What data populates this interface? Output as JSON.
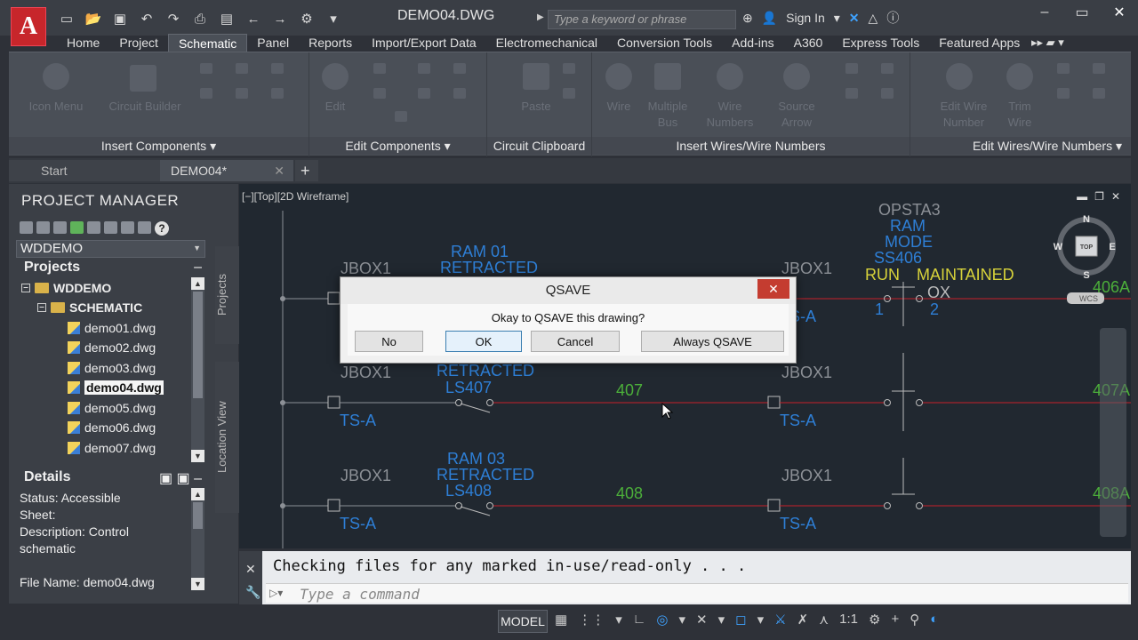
{
  "app": {
    "logo_letter": "A",
    "document_title": "DEMO04.DWG",
    "search_placeholder": "Type a keyword or phrase",
    "sign_in": "Sign In"
  },
  "ribbon": {
    "tabs": [
      "Home",
      "Project",
      "Schematic",
      "Panel",
      "Reports",
      "Import/Export Data",
      "Electromechanical",
      "Conversion Tools",
      "Add-ins",
      "A360",
      "Express Tools",
      "Featured Apps"
    ],
    "active_tab": "Schematic",
    "groups": [
      {
        "label": "Insert Components",
        "tools": [
          "Icon Menu",
          "Circuit Builder"
        ]
      },
      {
        "label": "Edit Components",
        "tools": [
          "Edit"
        ]
      },
      {
        "label": "Circuit Clipboard",
        "tools": [
          "Paste"
        ]
      },
      {
        "label": "Insert Wires/Wire Numbers",
        "tools": [
          "Wire",
          "Multiple Bus",
          "Wire Numbers",
          "Source Arrow"
        ]
      },
      {
        "label": "Edit Wires/Wire Numbers",
        "tools": [
          "Edit Wire Number",
          "Trim Wire"
        ]
      }
    ]
  },
  "doc_tabs": {
    "start": "Start",
    "current": "DEMO04*",
    "add": "+"
  },
  "project_manager": {
    "title": "PROJECT MANAGER",
    "project_select": "WDDEMO",
    "projects_header": "Projects",
    "tree": {
      "project": "WDDEMO",
      "folder": "SCHEMATIC",
      "files": [
        "demo01.dwg",
        "demo02.dwg",
        "demo03.dwg",
        "demo04.dwg",
        "demo05.dwg",
        "demo06.dwg",
        "demo07.dwg"
      ],
      "selected_file": "demo04.dwg"
    },
    "side_tabs": [
      "Projects",
      "Location View"
    ],
    "details_header": "Details",
    "details": [
      "Status: Accessible",
      "Sheet:",
      "Description: Control",
      "schematic",
      "",
      "File Name: demo04.dwg"
    ]
  },
  "viewport": {
    "label": "[−][Top][2D Wireframe]",
    "viewcube": {
      "top": "TOP",
      "n": "N",
      "s": "S",
      "e": "E",
      "w": "W",
      "wcs": "WCS"
    }
  },
  "drawing": {
    "texts": {
      "jbox": "JBOX1",
      "tsa": "TS-A",
      "ram01a": "RAM 01",
      "ram01b": "RETRACTED",
      "ram02b": "RETRACTED",
      "ls407": "LS407",
      "ram03a": "RAM 03",
      "ram03b": "RETRACTED",
      "ls408": "LS408",
      "w407": "407",
      "w408": "408",
      "w406a": "406A",
      "w407a": "407A",
      "w408a": "408A",
      "opsta": "OPSTA3",
      "ram": "RAM",
      "mode": "MODE",
      "ss406": "SS406",
      "run": "RUN",
      "maintained": "MAINTAINED",
      "ox": "OX",
      "n1": "1",
      "n2": "2"
    }
  },
  "dialog": {
    "title": "QSAVE",
    "message": "Okay to QSAVE this drawing?",
    "buttons": {
      "no": "No",
      "ok": "OK",
      "cancel": "Cancel",
      "always": "Always QSAVE"
    }
  },
  "command_line": {
    "history": "Checking files for any marked in-use/read-only . . .",
    "placeholder": "Type a command"
  },
  "status_bar": {
    "model": "MODEL",
    "scale": "1:1"
  },
  "colors": {
    "wire_red": "#c8202a",
    "label_blue": "#2e7fd6",
    "label_yellow": "#d7d23a",
    "wire_number_green": "#4caf3a",
    "neutral_gray": "#8c9096"
  }
}
